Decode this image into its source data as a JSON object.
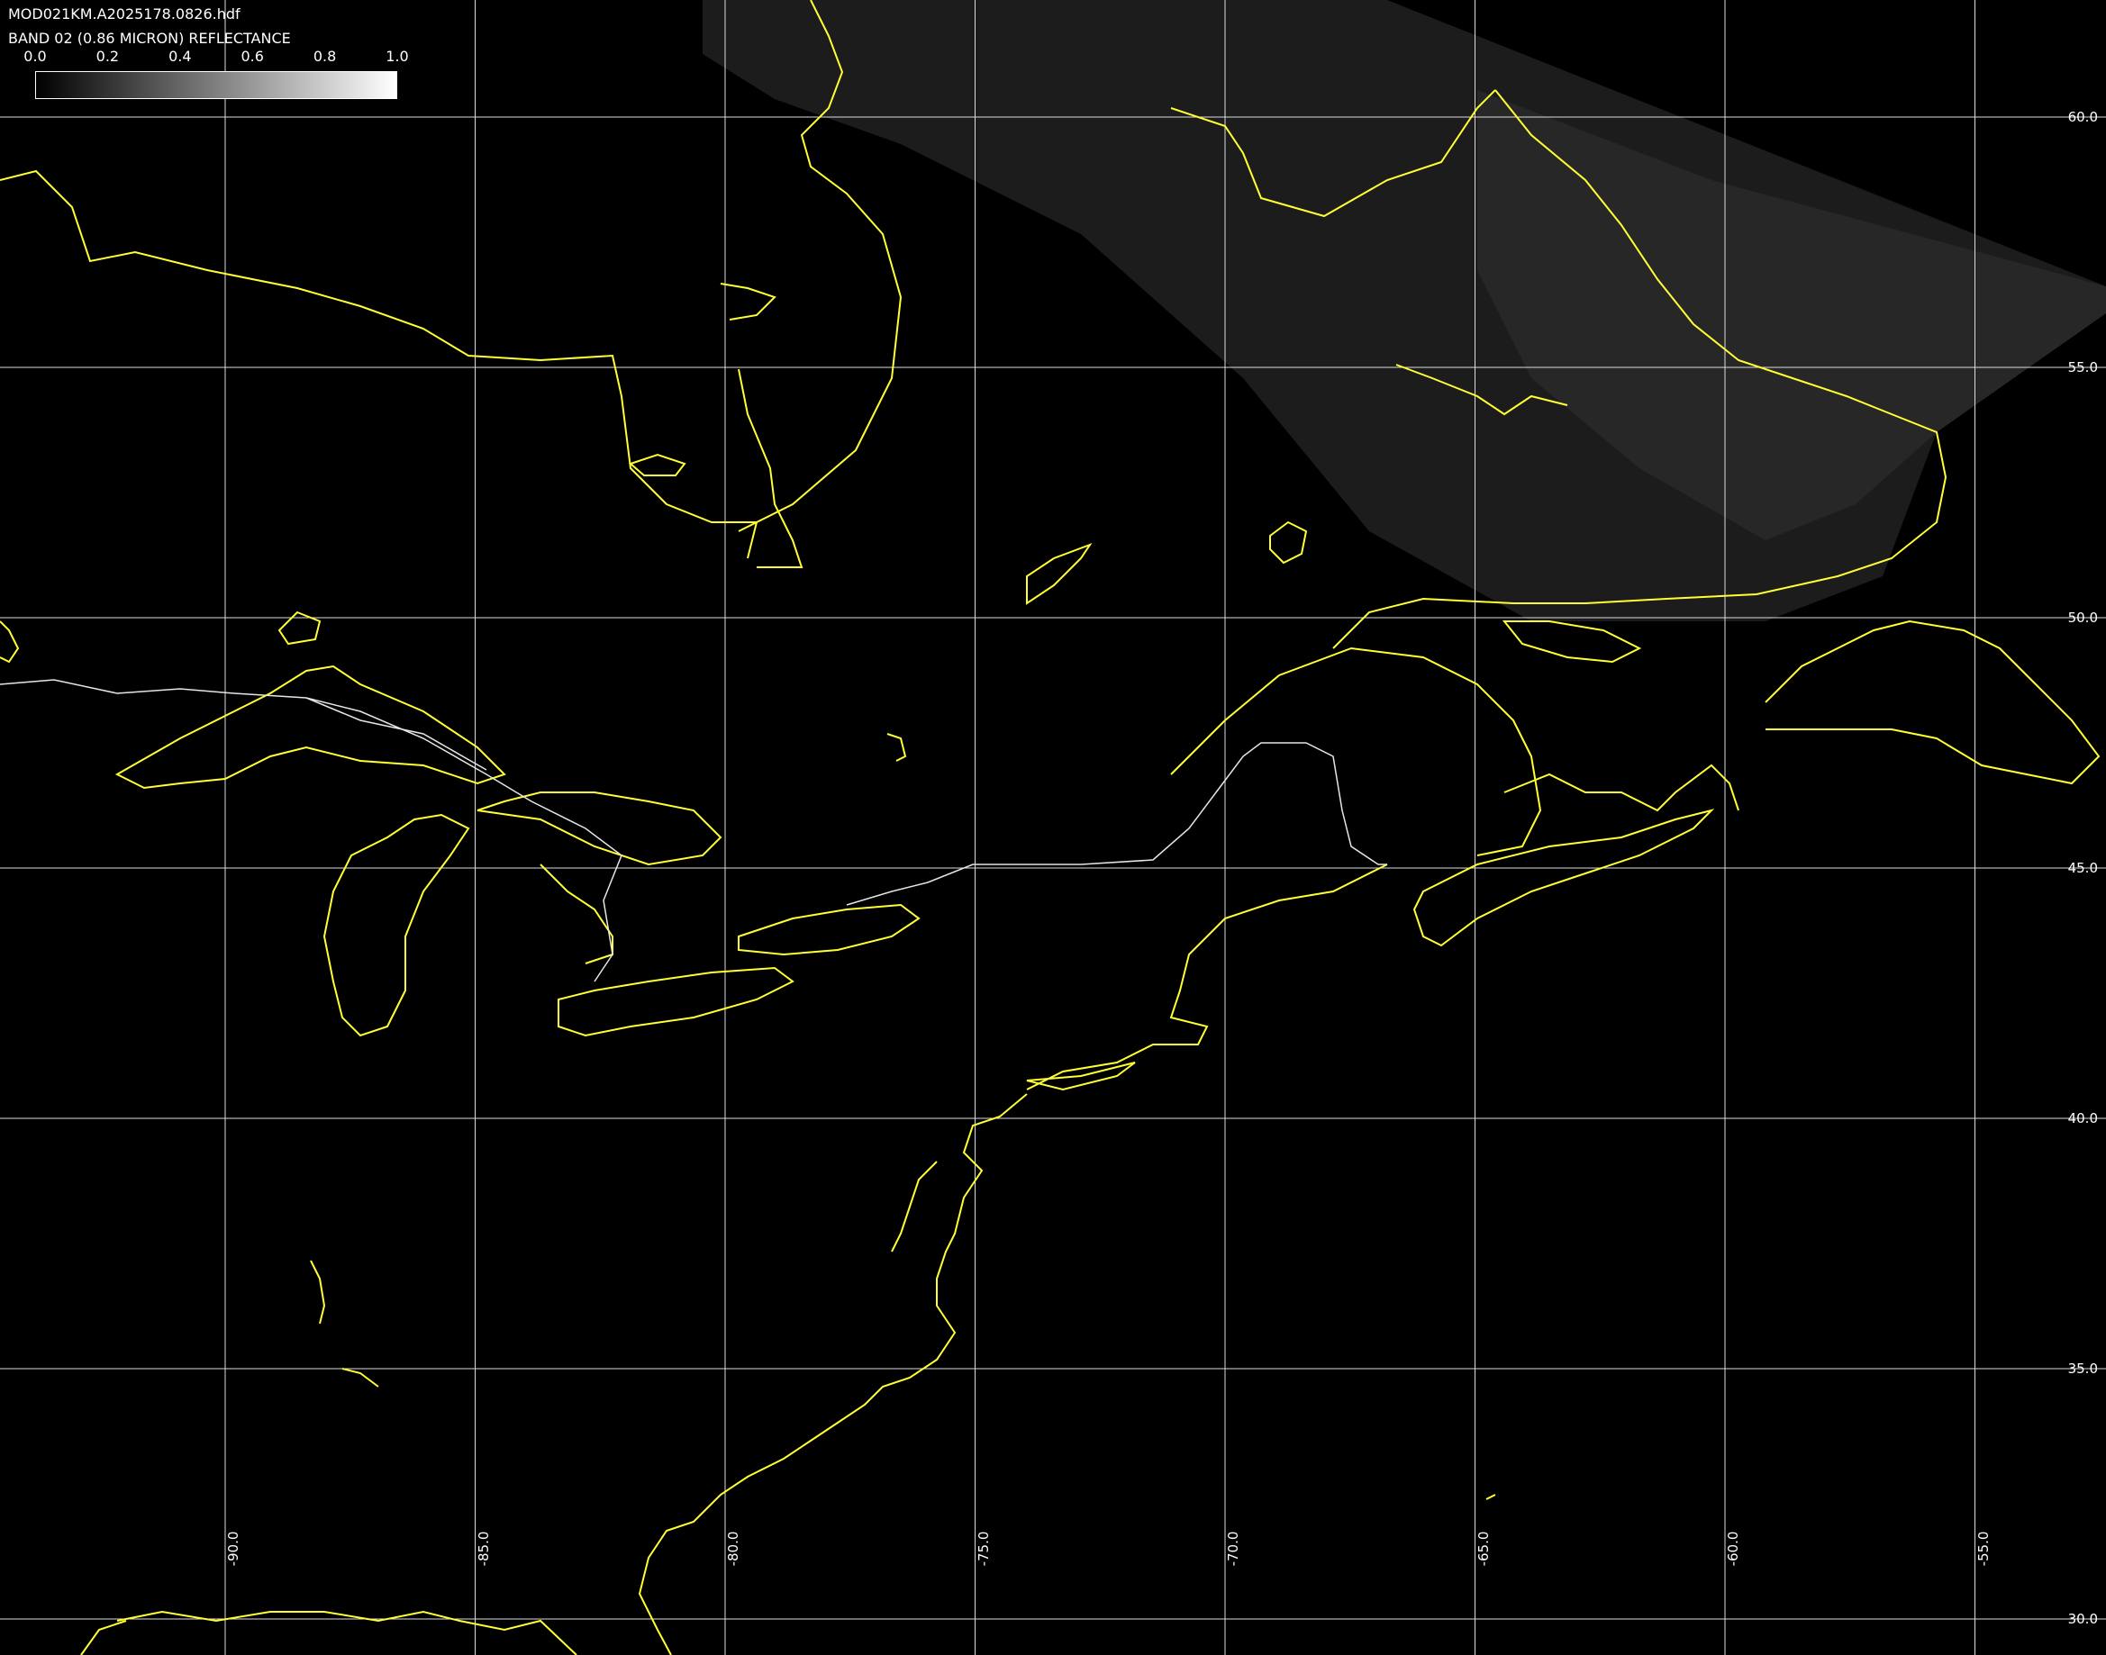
{
  "header": {
    "file_name": "MOD021KM.A2025178.0826.hdf",
    "band_title": "BAND 02 (0.86 MICRON) REFLECTANCE"
  },
  "colorbar": {
    "tick_labels": [
      "0.0",
      "0.2",
      "0.4",
      "0.6",
      "0.8",
      "1.0"
    ],
    "range": [
      0.0,
      1.0
    ],
    "colors": {
      "low": "#000000",
      "high": "#ffffff"
    }
  },
  "grid": {
    "latitudes": [
      60.0,
      55.0,
      50.0,
      45.0,
      40.0,
      35.0,
      30.0
    ],
    "latitude_labels": [
      "60.0",
      "55.0",
      "50.0",
      "45.0",
      "40.0",
      "35.0",
      "30.0"
    ],
    "longitudes": [
      -90.0,
      -85.0,
      -80.0,
      -75.0,
      -70.0,
      -65.0,
      -60.0,
      -55.0
    ],
    "longitude_labels": [
      "-90.0",
      "-85.0",
      "-80.0",
      "-75.0",
      "-70.0",
      "-65.0",
      "-60.0",
      "-55.0"
    ],
    "line_color": "#dcdcdc"
  },
  "map_style": {
    "coastline_color": "#ffff33",
    "border_color": "#e6e6e6",
    "background": "#000000",
    "swath_tone": "#222222"
  }
}
